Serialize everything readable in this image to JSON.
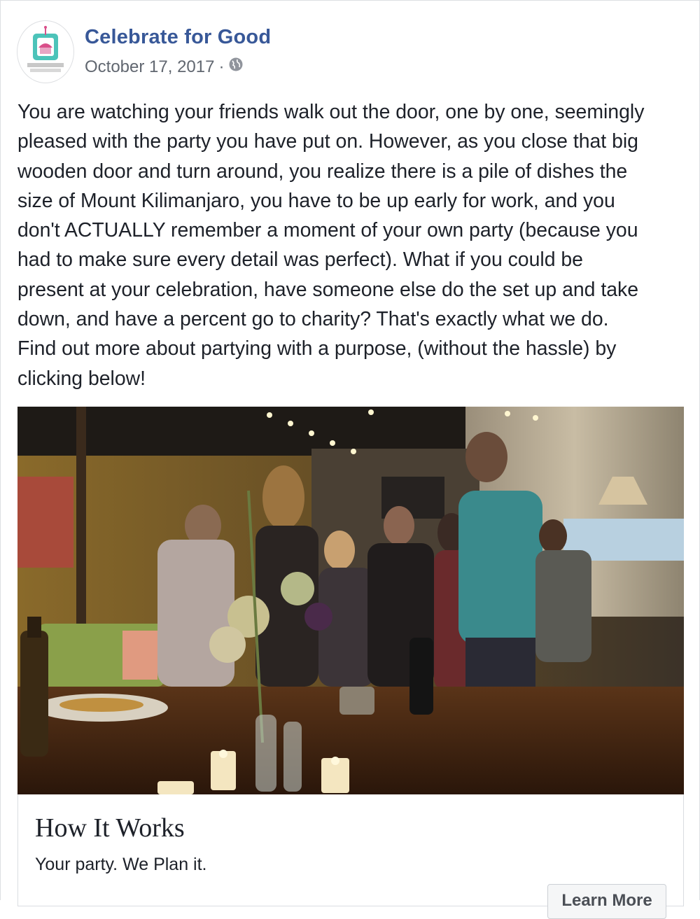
{
  "post": {
    "page_name": "Celebrate for Good",
    "date": "October 17, 2017",
    "separator": "·",
    "audience_icon": "globe-icon",
    "text": "You are watching your friends walk out the door, one by one, seemingly\npleased with the party you have put on. However, as you close that big\nwooden door and turn around, you realize there is a pile of dishes the\nsize of Mount Kilimanjaro, you have to be up early for work, and you\ndon't ACTUALLY remember a moment of your own party (because you\nhad to make sure every detail was perfect). What if you could be\npresent at your celebration, have someone else do the set up and take\ndown, and have a percent go to charity? That's exactly what we do.\nFind out more about partying with a purpose, (without the hassle) by\nclicking below!"
  },
  "link_card": {
    "title": "How It Works",
    "description": "Your party. We Plan it.",
    "cta_label": "Learn More"
  },
  "colors": {
    "link_blue": "#385898",
    "meta_gray": "#616770",
    "logo_teal": "#4cc3b9",
    "logo_pink": "#d94f8a"
  }
}
